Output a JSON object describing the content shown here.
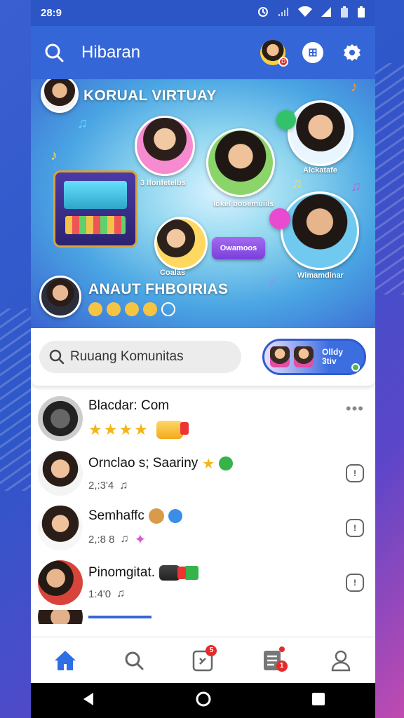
{
  "status_bar": {
    "time": "28:9"
  },
  "app_bar": {
    "title": "Hibaran"
  },
  "hero": {
    "top_title": "KORUAL VIRTUAY",
    "bottom_title": "ANAUT FHBOIRIAS",
    "labels": [
      "3 lfonfetelbs",
      "lokel booemuiils",
      "Alckatafe",
      "Coalas",
      "Wimamdinar"
    ],
    "pill_label": "Owamoos"
  },
  "search": {
    "placeholder": "Ruuang Komunitas"
  },
  "promo": {
    "line1": "Olldy",
    "line2": "3tiv"
  },
  "list": [
    {
      "title": "Blacdar: Com",
      "sub": ""
    },
    {
      "title": "Ornclao s; Saariny",
      "sub": "2,:3'4"
    },
    {
      "title": "Semhaffc",
      "sub": "2,:8 8"
    },
    {
      "title": "Pinomgitat.",
      "sub": "1:4'0"
    }
  ],
  "bottom_nav": {
    "badge_count": "5",
    "tasks_badge": "1"
  },
  "colors": {
    "primary": "#3566d8",
    "status": "#2c55c6",
    "accent": "#f4b614"
  }
}
